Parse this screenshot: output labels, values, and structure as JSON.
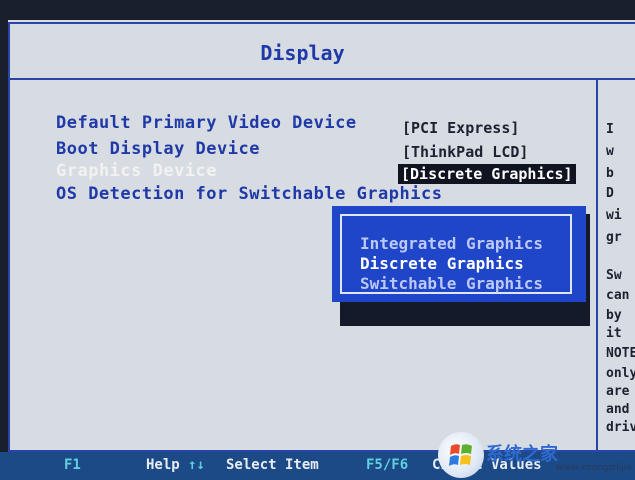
{
  "title": "Display",
  "menu": [
    {
      "label": "Default Primary Video Device",
      "value": "[PCI Express]"
    },
    {
      "label": "Boot Display Device",
      "value": "[ThinkPad LCD]"
    },
    {
      "label": "Graphics Device",
      "value": "[Discrete Graphics]"
    },
    {
      "label": "OS Detection for Switchable Graphics",
      "value": ""
    }
  ],
  "popup": {
    "options": [
      "Integrated Graphics",
      "Discrete Graphics",
      "Switchable Graphics"
    ],
    "selected_index": 1
  },
  "help_lines": [
    "I",
    "w",
    "b",
    "D",
    "wi",
    "gr",
    "",
    "Sw",
    "can",
    "by",
    "it",
    "NOTE",
    "only",
    "are",
    "and t",
    "drive"
  ],
  "footer": {
    "f1_key": "F1",
    "f1_help": "Help",
    "arrows": "↑↓",
    "select_item": "Select Item",
    "f5f6_key": "F5/F6",
    "change_values": "Change Values"
  },
  "watermark": {
    "brand": "系统之家",
    "url": "www.xitongzhijia.net"
  },
  "colors": {
    "title_text": "#1f3aa8",
    "popup_bg": "#1f45c8",
    "footer_bg": "#1b4a86",
    "screen_bg": "#d7dbe2"
  }
}
